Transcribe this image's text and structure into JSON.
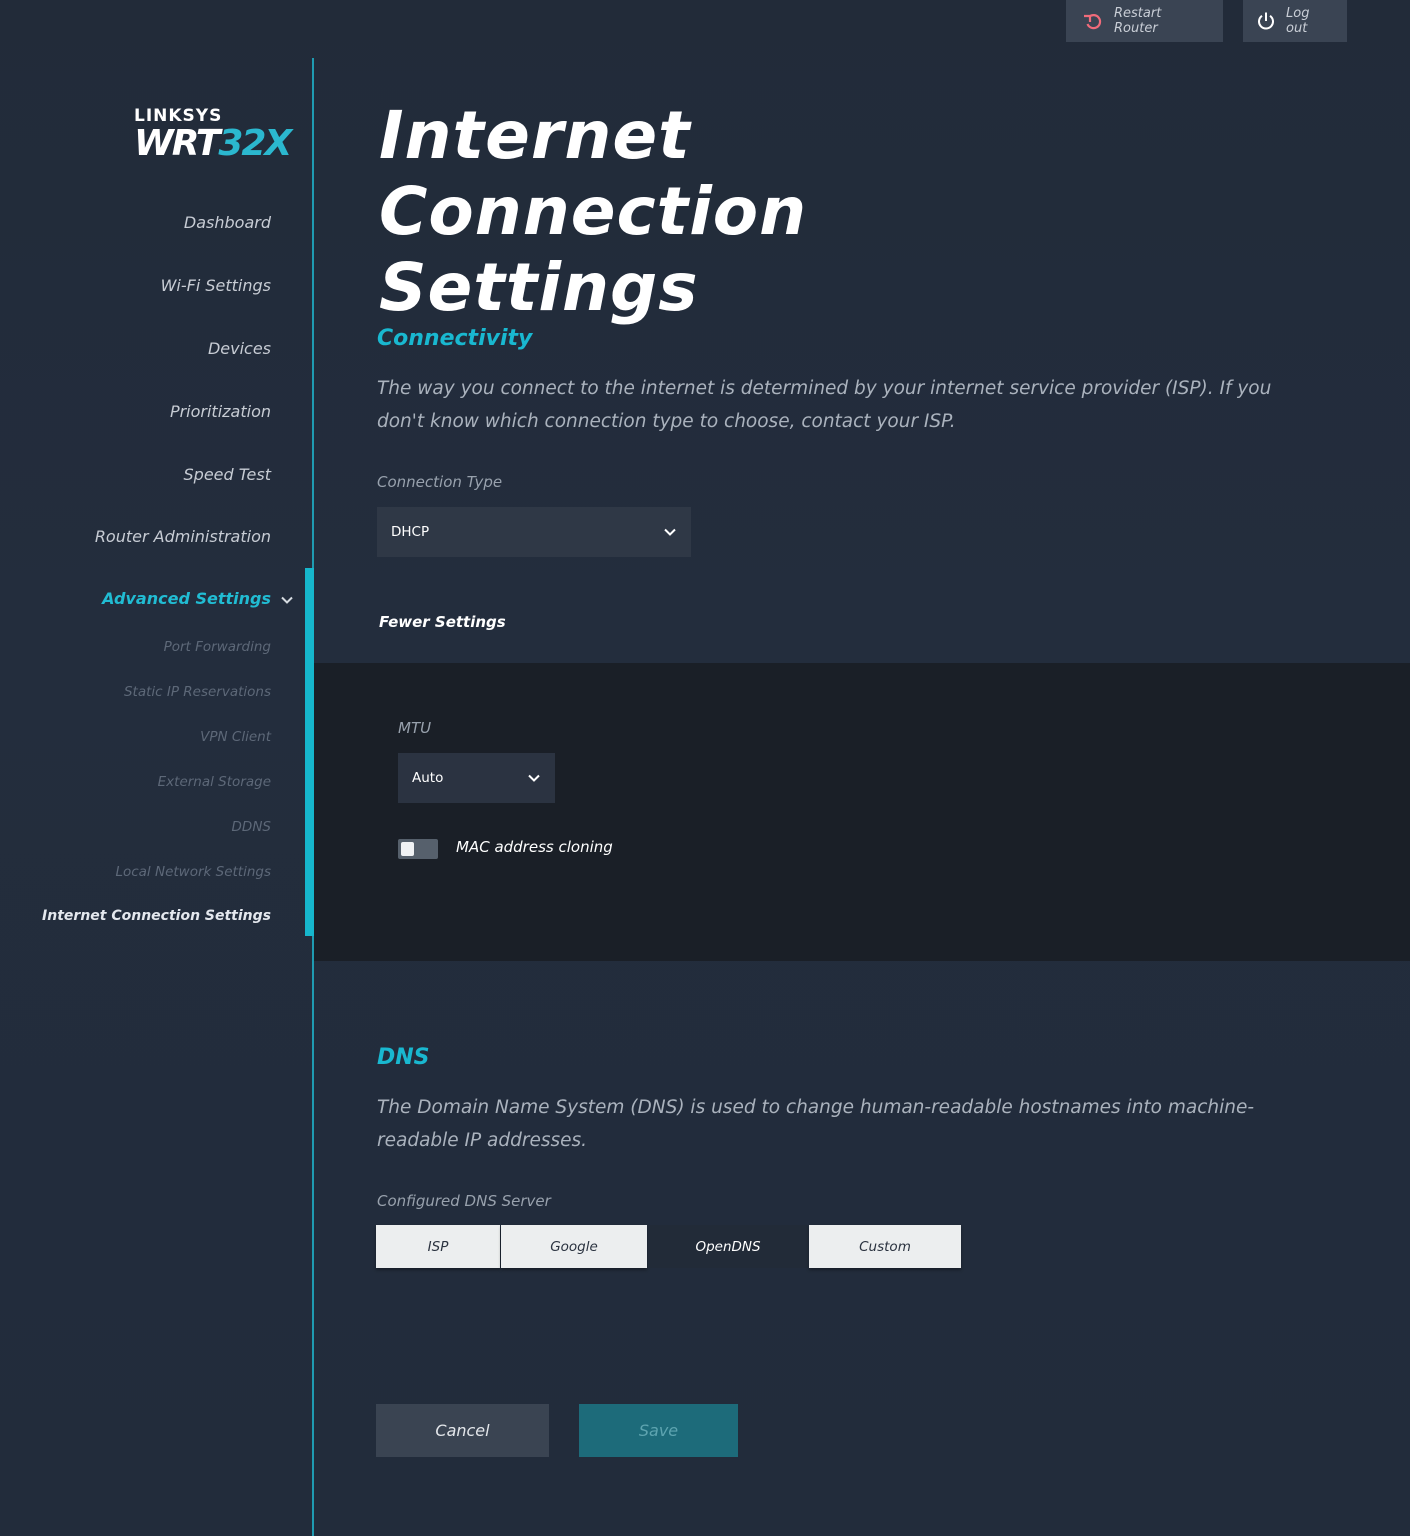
{
  "header": {
    "restart_label": "Restart Router",
    "logout_label": "Log out"
  },
  "logo": {
    "brand": "LINKSYS",
    "model_prefix": "WRT",
    "model_suffix": "32X"
  },
  "sidebar": {
    "items": [
      {
        "label": "Dashboard"
      },
      {
        "label": "Wi-Fi Settings"
      },
      {
        "label": "Devices"
      },
      {
        "label": "Prioritization"
      },
      {
        "label": "Speed Test"
      },
      {
        "label": "Router Administration"
      },
      {
        "label": "Advanced Settings"
      }
    ],
    "sub_items": [
      {
        "label": "Port Forwarding"
      },
      {
        "label": "Static IP Reservations"
      },
      {
        "label": "VPN Client"
      },
      {
        "label": "External Storage"
      },
      {
        "label": "DDNS"
      },
      {
        "label": "Local Network Settings"
      },
      {
        "label": "Internet Connection Settings"
      }
    ]
  },
  "main": {
    "title": "Internet Connection Settings",
    "connectivity": {
      "heading": "Connectivity",
      "description": "The way you connect to the internet is determined by your internet service provider (ISP). If you don't know which connection type to choose, contact your ISP.",
      "connection_type_label": "Connection Type",
      "connection_type_value": "DHCP",
      "fewer_settings": "Fewer Settings",
      "mtu_label": "MTU",
      "mtu_value": "Auto",
      "mac_cloning_label": "MAC address cloning",
      "mac_cloning_on": false
    },
    "dns": {
      "heading": "DNS",
      "description": "The Domain Name System (DNS) is used to change human-readable hostnames into machine-readable IP addresses.",
      "server_label": "Configured DNS Server",
      "options": [
        "ISP",
        "Google",
        "OpenDNS",
        "Custom"
      ],
      "selected": "OpenDNS"
    },
    "actions": {
      "cancel": "Cancel",
      "save": "Save"
    }
  },
  "colors": {
    "accent": "#19b8d0",
    "background": "#222b39",
    "panel": "#1a1f27",
    "restart_icon": "#f06b7a"
  },
  "icons": {
    "restart": "restart-icon",
    "logout": "power-icon",
    "select": "chevron-down-icon"
  }
}
